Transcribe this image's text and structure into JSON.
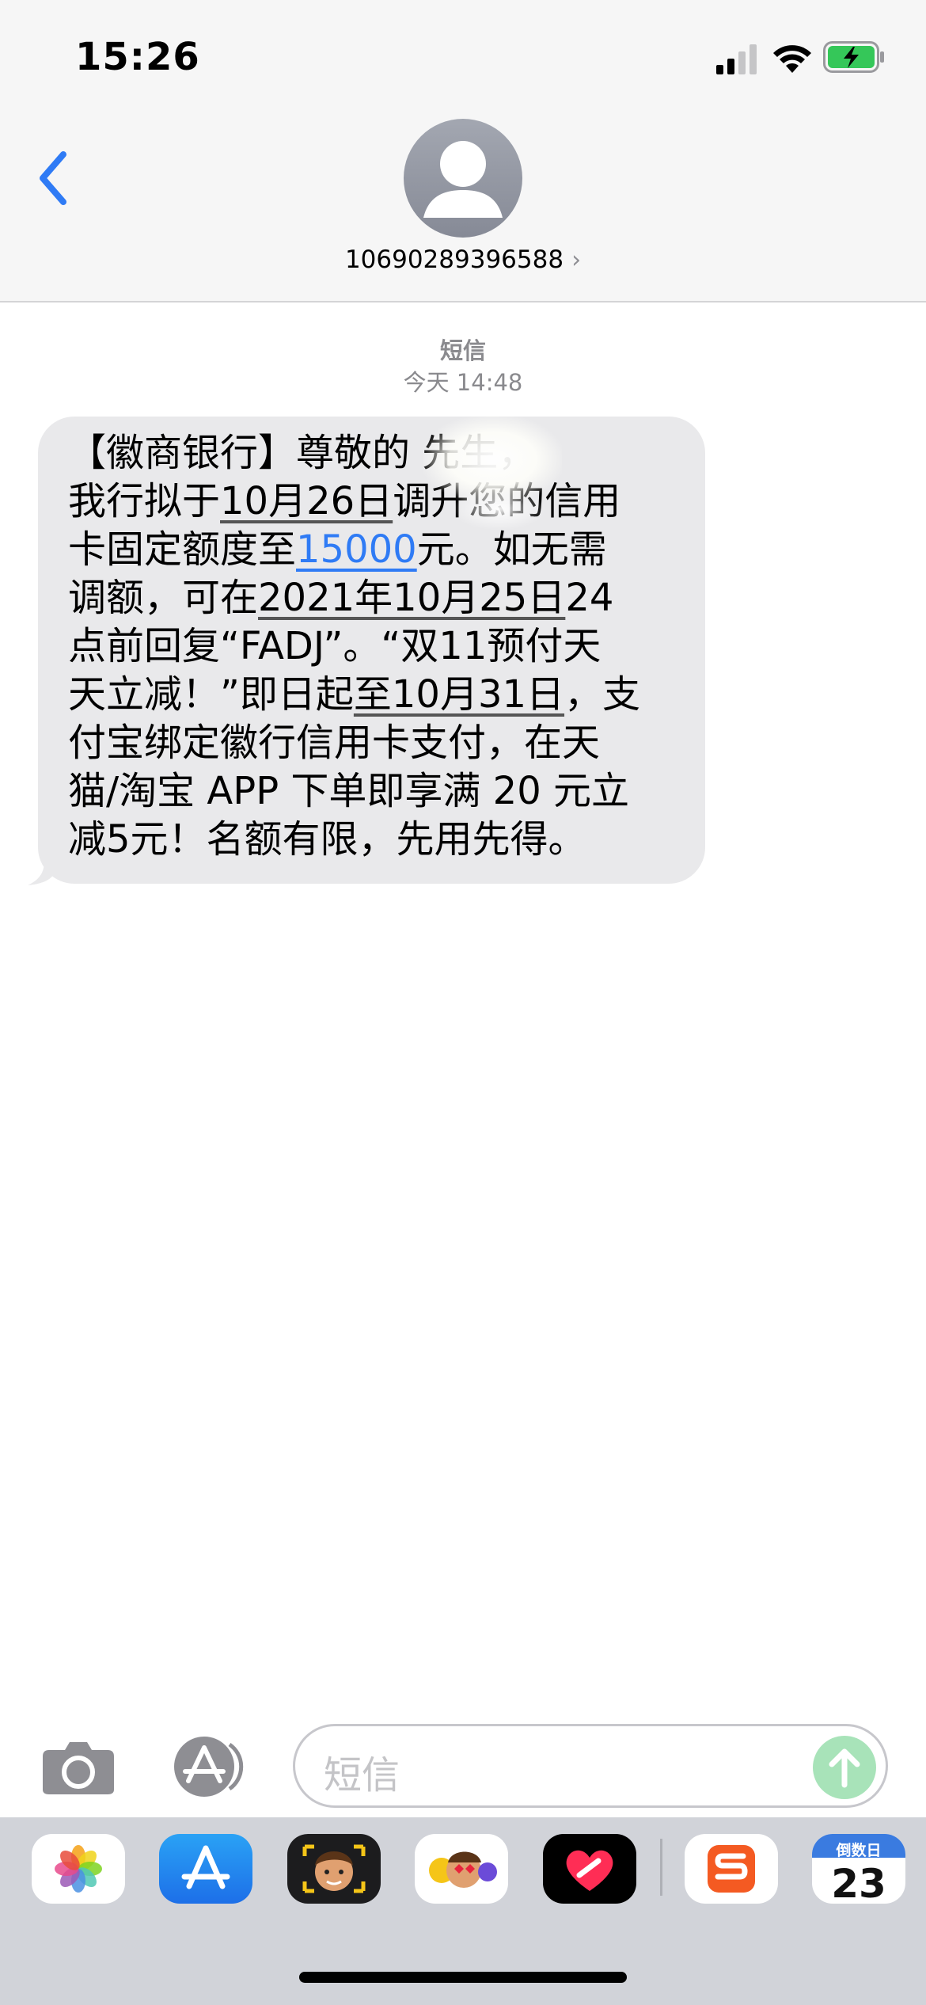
{
  "status_bar": {
    "time": "15:26"
  },
  "header": {
    "contact": "10690289396588",
    "contact_chevron": "›"
  },
  "conversation": {
    "type_label": "短信",
    "timestamp": "今天 14:48",
    "message": {
      "line1": "【徽商银行】尊敬的 先生，",
      "line2_a": "我行拟于",
      "line2_date": "10月26日",
      "line2_b": "调升您的信用",
      "line3_a": "卡固定额度至",
      "line3_amount": "15000",
      "line3_b": "元。如无需",
      "line4_a": "调额，可在",
      "line4_date": "2021年10月25日",
      "line4_b": "24",
      "line5": "点前回复“FADJ”。“双11预付天",
      "line6_a": "天立减！”即日起",
      "line6_date": "至10月31日",
      "line6_b": "，支",
      "line7": "付宝绑定徽行信用卡支付，在天",
      "line8": "猫/淘宝 APP 下单即享满 20 元立",
      "line9": "减5元！名额有限，先用先得。"
    }
  },
  "input_bar": {
    "placeholder": "短信"
  },
  "app_drawer": {
    "apps": [
      {
        "icon": "photos-icon"
      },
      {
        "icon": "app-store-icon"
      },
      {
        "icon": "memoji-icon"
      },
      {
        "icon": "animoji-icon"
      },
      {
        "icon": "digital-touch-icon"
      },
      {
        "icon": "sogou-icon"
      },
      {
        "icon": "countdown-icon",
        "label": "倒数日",
        "number": "23"
      }
    ]
  },
  "colors": {
    "accent_blue": "#2f7bf5",
    "bubble_gray": "#e9e9eb",
    "header_bg": "#f6f6f6",
    "send_green": "#a8e3b9"
  }
}
